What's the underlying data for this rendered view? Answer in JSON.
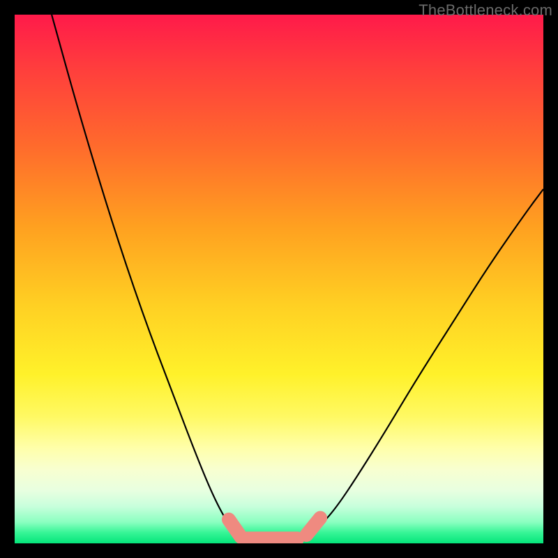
{
  "watermark": "TheBottleneck.com",
  "chart_data": {
    "type": "line",
    "title": "",
    "xlabel": "",
    "ylabel": "",
    "xlim": [
      0,
      100
    ],
    "ylim": [
      0,
      100
    ],
    "grid": false,
    "legend": false,
    "series": [
      {
        "name": "left-curve",
        "x": [
          7,
          12,
          18,
          24,
          30,
          35,
          38,
          40.5,
          42.5,
          44
        ],
        "y": [
          100,
          82,
          62,
          44,
          28,
          15,
          8,
          3.5,
          1.5,
          0.6
        ]
      },
      {
        "name": "right-curve",
        "x": [
          54.5,
          56,
          58,
          61,
          65,
          70,
          76,
          83,
          90,
          97,
          100
        ],
        "y": [
          0.6,
          1.5,
          3.5,
          7,
          13,
          21,
          31,
          42,
          53,
          63,
          67
        ]
      },
      {
        "name": "valley-floor",
        "x": [
          44,
          46,
          48,
          50,
          52,
          54.5
        ],
        "y": [
          0.6,
          0.4,
          0.3,
          0.3,
          0.4,
          0.6
        ]
      }
    ],
    "markers": [
      {
        "name": "left-pill",
        "x1": 40.5,
        "y1": 4.5,
        "x2": 42.8,
        "y2": 1.2
      },
      {
        "name": "floor-pill",
        "x1": 44.0,
        "y1": 0.9,
        "x2": 53.5,
        "y2": 0.9
      },
      {
        "name": "right-pill",
        "x1": 55.2,
        "y1": 1.6,
        "x2": 57.8,
        "y2": 4.8
      }
    ]
  }
}
